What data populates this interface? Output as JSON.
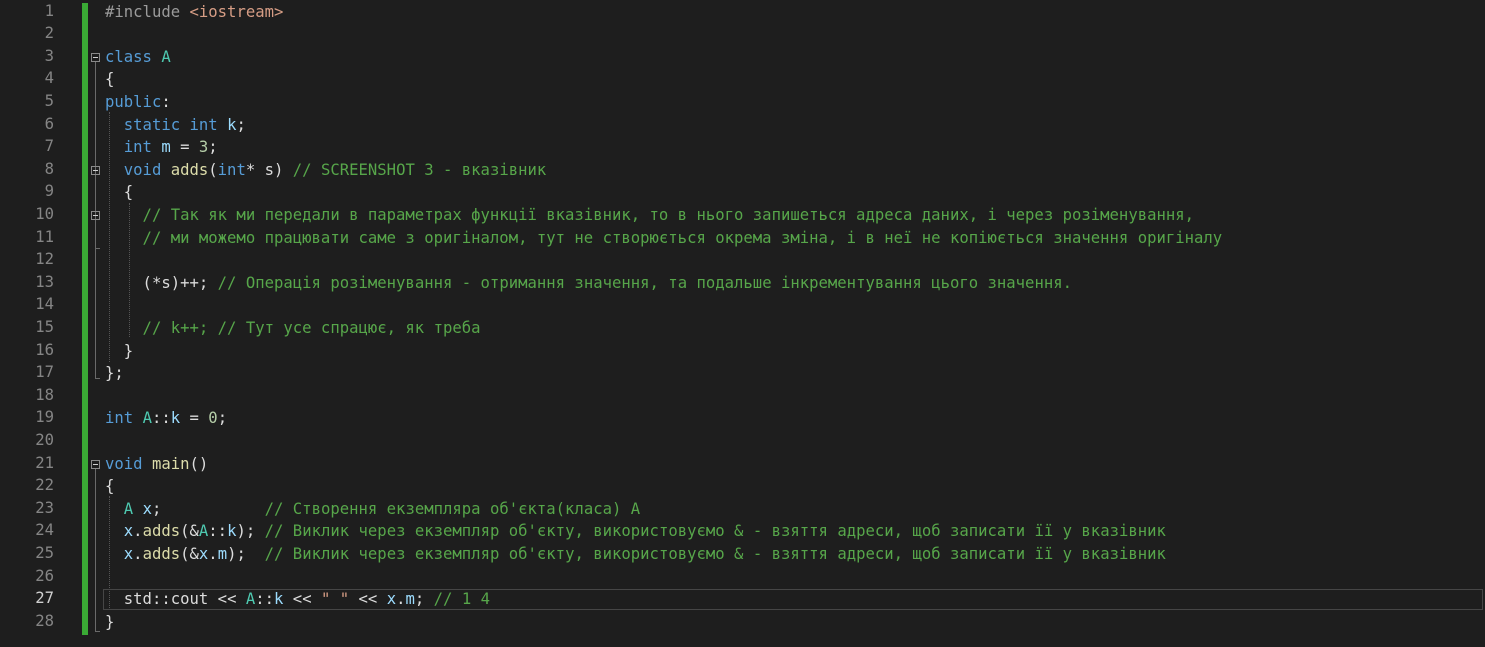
{
  "editor": {
    "current_line": "27",
    "lines": [
      {
        "num": "1",
        "tokens": [
          {
            "t": "#include ",
            "c": "pp"
          },
          {
            "t": "<iostream>",
            "c": "str"
          }
        ]
      },
      {
        "num": "2",
        "tokens": []
      },
      {
        "num": "3",
        "tokens": [
          {
            "t": "class ",
            "c": "kw"
          },
          {
            "t": "A",
            "c": "cls"
          }
        ]
      },
      {
        "num": "4",
        "tokens": [
          {
            "t": "{",
            "c": ""
          }
        ]
      },
      {
        "num": "5",
        "tokens": [
          {
            "t": "public",
            "c": "kw"
          },
          {
            "t": ":",
            "c": ""
          }
        ]
      },
      {
        "num": "6",
        "tokens": [
          {
            "t": "  static ",
            "c": "kw"
          },
          {
            "t": "int ",
            "c": "kw"
          },
          {
            "t": "k",
            "c": "var"
          },
          {
            "t": ";",
            "c": ""
          }
        ]
      },
      {
        "num": "7",
        "tokens": [
          {
            "t": "  int ",
            "c": "kw"
          },
          {
            "t": "m",
            "c": "var"
          },
          {
            "t": " = ",
            "c": ""
          },
          {
            "t": "3",
            "c": "num"
          },
          {
            "t": ";",
            "c": ""
          }
        ]
      },
      {
        "num": "8",
        "tokens": [
          {
            "t": "  void ",
            "c": "kw"
          },
          {
            "t": "adds",
            "c": "fn"
          },
          {
            "t": "(",
            "c": ""
          },
          {
            "t": "int",
            "c": "kw"
          },
          {
            "t": "* s) ",
            "c": ""
          },
          {
            "t": "// SCREENSHOT 3 - вказівник",
            "c": "cm"
          }
        ]
      },
      {
        "num": "9",
        "tokens": [
          {
            "t": "  {",
            "c": ""
          }
        ]
      },
      {
        "num": "10",
        "tokens": [
          {
            "t": "    // Так як ми передали в параметрах функції вказівник, то в нього запишеться адреса даних, і через розіменування,",
            "c": "cm"
          }
        ]
      },
      {
        "num": "11",
        "tokens": [
          {
            "t": "    // ми можемо працювати саме з оригіналом, тут не створюється окрема зміна, і в неї не копіюється значення оригіналу",
            "c": "cm"
          }
        ]
      },
      {
        "num": "12",
        "tokens": []
      },
      {
        "num": "13",
        "tokens": [
          {
            "t": "    (*s)++; ",
            "c": ""
          },
          {
            "t": "// Операція розіменування - отримання значення, та подальше інкрементування цього значення.",
            "c": "cm"
          }
        ]
      },
      {
        "num": "14",
        "tokens": []
      },
      {
        "num": "15",
        "tokens": [
          {
            "t": "    // k++; // Тут усе спрацює, як треба",
            "c": "cm"
          }
        ]
      },
      {
        "num": "16",
        "tokens": [
          {
            "t": "  }",
            "c": ""
          }
        ]
      },
      {
        "num": "17",
        "tokens": [
          {
            "t": "};",
            "c": ""
          }
        ]
      },
      {
        "num": "18",
        "tokens": []
      },
      {
        "num": "19",
        "tokens": [
          {
            "t": "int ",
            "c": "kw"
          },
          {
            "t": "A",
            "c": "cls"
          },
          {
            "t": "::",
            "c": ""
          },
          {
            "t": "k",
            "c": "var"
          },
          {
            "t": " = ",
            "c": ""
          },
          {
            "t": "0",
            "c": "num"
          },
          {
            "t": ";",
            "c": ""
          }
        ]
      },
      {
        "num": "20",
        "tokens": []
      },
      {
        "num": "21",
        "tokens": [
          {
            "t": "void ",
            "c": "kw"
          },
          {
            "t": "main",
            "c": "fn"
          },
          {
            "t": "()",
            "c": ""
          }
        ]
      },
      {
        "num": "22",
        "tokens": [
          {
            "t": "{",
            "c": ""
          }
        ]
      },
      {
        "num": "23",
        "tokens": [
          {
            "t": "  A ",
            "c": "cls"
          },
          {
            "t": "x",
            "c": "var"
          },
          {
            "t": ";           ",
            "c": ""
          },
          {
            "t": "// Створення екземпляра об'єкта(класа) А",
            "c": "cm"
          }
        ]
      },
      {
        "num": "24",
        "tokens": [
          {
            "t": "  x",
            "c": "var"
          },
          {
            "t": ".",
            "c": ""
          },
          {
            "t": "adds",
            "c": "fn"
          },
          {
            "t": "(&",
            "c": ""
          },
          {
            "t": "A",
            "c": "cls"
          },
          {
            "t": "::",
            "c": ""
          },
          {
            "t": "k",
            "c": "var"
          },
          {
            "t": "); ",
            "c": ""
          },
          {
            "t": "// Виклик через екземпляр об'єкту, використовуємо & - взяття адреси, щоб записати її у вказівник",
            "c": "cm"
          }
        ]
      },
      {
        "num": "25",
        "tokens": [
          {
            "t": "  x",
            "c": "var"
          },
          {
            "t": ".",
            "c": ""
          },
          {
            "t": "adds",
            "c": "fn"
          },
          {
            "t": "(&",
            "c": ""
          },
          {
            "t": "x",
            "c": "var"
          },
          {
            "t": ".",
            "c": ""
          },
          {
            "t": "m",
            "c": "var"
          },
          {
            "t": ");  ",
            "c": ""
          },
          {
            "t": "// Виклик через екземпляр об'єкту, використовуємо & - взяття адреси, щоб записати її у вказівник",
            "c": "cm"
          }
        ]
      },
      {
        "num": "26",
        "tokens": []
      },
      {
        "num": "27",
        "tokens": [
          {
            "t": "  std",
            "c": ""
          },
          {
            "t": "::",
            "c": ""
          },
          {
            "t": "cout",
            "c": ""
          },
          {
            "t": " << ",
            "c": ""
          },
          {
            "t": "A",
            "c": "cls"
          },
          {
            "t": "::",
            "c": ""
          },
          {
            "t": "k",
            "c": "var"
          },
          {
            "t": " << ",
            "c": ""
          },
          {
            "t": "\" \"",
            "c": "str"
          },
          {
            "t": " << ",
            "c": ""
          },
          {
            "t": "x",
            "c": "var"
          },
          {
            "t": ".",
            "c": ""
          },
          {
            "t": "m",
            "c": "var"
          },
          {
            "t": "; ",
            "c": ""
          },
          {
            "t": "// 1 4",
            "c": "cm"
          }
        ]
      },
      {
        "num": "28",
        "tokens": [
          {
            "t": "}",
            "c": ""
          }
        ]
      }
    ],
    "fold_markers": [
      "3",
      "8",
      "10",
      "21"
    ],
    "colors": {
      "background": "#1e1e1e",
      "keyword": "#569cd6",
      "class": "#4ec9b0",
      "function": "#dcdcaa",
      "string": "#d69d85",
      "comment": "#57a64a",
      "number": "#b5cea8",
      "variable": "#9cdcfe",
      "changed_bar": "#3aaa35"
    }
  }
}
